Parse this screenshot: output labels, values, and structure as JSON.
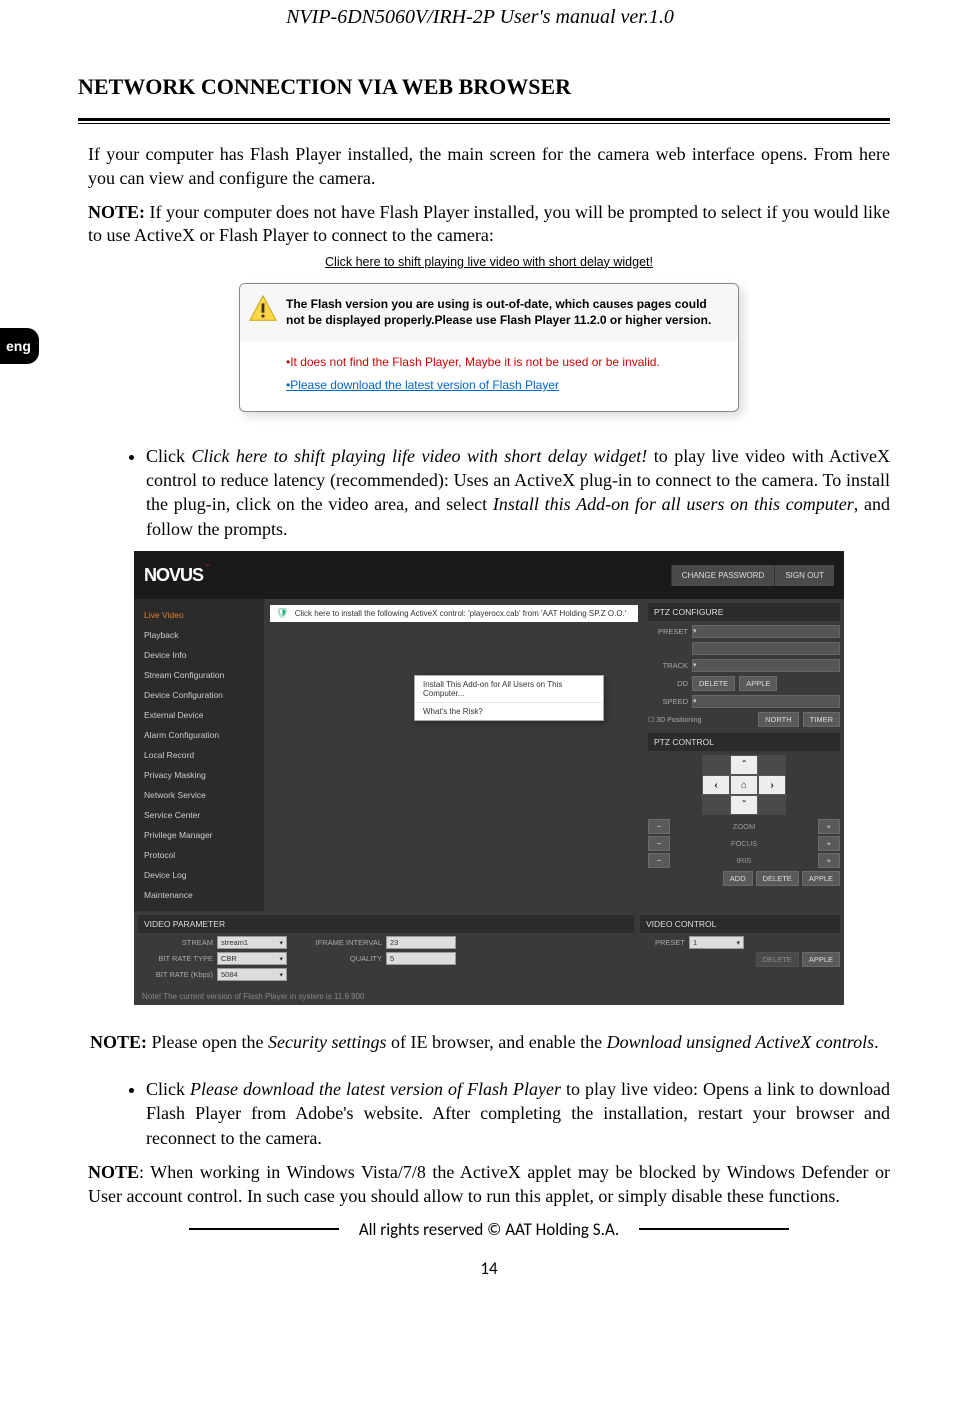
{
  "headerTitle": "NVIP-6DN5060V/IRH-2P User's manual ver.1.0",
  "langTab": "eng",
  "sectionTitle": "NETWORK CONNECTION VIA WEB BROWSER",
  "intro1": "If your computer has Flash Player installed, the main screen for the camera web interface opens. From here you can view and configure the camera.",
  "noteLabel": "NOTE:",
  "note1body": " If your computer does not have Flash Player installed, you will be prompted to select if you would like to use ActiveX or Flash Player to connect to the camera:",
  "shiftLink": "Click here to shift playing live video with short delay widget!",
  "flashBold": "The Flash version you are using is out-of-date, which causes pages could not be displayed properly.Please use Flash Player 11.2.0 or higher version.",
  "flashRed": "•It does not find the Flash Player, Maybe it is not be used or be invalid.",
  "flashBlue": "•Please download the latest version of Flash Player",
  "bullet1_a": "Click ",
  "bullet1_italic1": "Click here to shift playing life video with short delay widget!",
  "bullet1_b": " to play live video with ActiveX control to reduce latency (recommended): Uses an ActiveX plug-in to connect to the camera. To install the plug-in, click on the video area, and select ",
  "bullet1_italic2": "Install this Add-on for all users on this computer",
  "bullet1_c": ", and follow the prompts.",
  "cam": {
    "logo": "NOVUS",
    "hdrBtn1": "CHANGE PASSWORD",
    "hdrBtn2": "SIGN OUT",
    "side": [
      "Live Video",
      "Playback",
      "Device Info",
      "Stream Configuration",
      "Device Configuration",
      "External Device",
      "Alarm Configuration",
      "Local Record",
      "Privacy Masking",
      "Network Service",
      "Service Center",
      "Privilege Manager",
      "Protocol",
      "Device Log",
      "Maintenance"
    ],
    "activexMsg": "Click here to install the following ActiveX control: 'playerocx.cab' from 'AAT Holding  SP.Z O.O.'",
    "ctx1": "Install This Add-on for All Users on This Computer...",
    "ctx2": "What's the Risk?",
    "ptzTitle": "PTZ CONFIGURE",
    "ptzLabels": {
      "preset": "PRESET",
      "track": "TRACK",
      "dd": "DD",
      "speed": "SPEED",
      "positioning": "3D Positioning",
      "north": "NORTH",
      "timer": "TIMER",
      "delete": "DELETE",
      "apple": "APPLE",
      "add": "ADD"
    },
    "ptzCtrlTitle": "PTZ CONTROL",
    "zoom": {
      "zoom": "ZOOM",
      "focus": "FOCUS",
      "iris": "IRIS"
    },
    "vpTitle": "VIDEO PARAMETER",
    "vp": {
      "streamLbl": "STREAM",
      "stream": "stream1",
      "brtLbl": "BIT RATE TYPE",
      "brt": "CBR",
      "brLbl": "BIT RATE (Kbps)",
      "br": "5084",
      "ifiLbl": "IFRAME INTERVAL",
      "ifi": "23",
      "qLbl": "QUALITY",
      "q": "5"
    },
    "vcTitle": "VIDEO CONTROL",
    "vc": {
      "presetLbl": "PRESET",
      "preset": "1",
      "delete": "DELETE",
      "apple": "APPLE"
    },
    "footerNote": "Note! The current version of Flash Player in system is 11.9.900"
  },
  "note2_a": "NOTE:",
  "note2_b": " Please open the ",
  "note2_i1": "Security settings",
  "note2_c": " of IE browser, and enable the ",
  "note2_i2": "Download unsigned ActiveX controls",
  "note2_d": ".",
  "bullet2_a": "Click ",
  "bullet2_i": "Please download the latest version of Flash Player",
  "bullet2_b": " to play live video: Opens a link to download Flash Player from Adobe's website. After completing the installation, restart your browser and reconnect to the camera.",
  "note3_a": "NOTE",
  "note3_b": ": When working in Windows Vista/7/8 the ActiveX applet may be blocked by Windows Defender or User account control. In such case you should allow to run this applet, or simply disable these functions.",
  "copyright": "All rights reserved © AAT Holding S.A.",
  "pageNum": "14"
}
